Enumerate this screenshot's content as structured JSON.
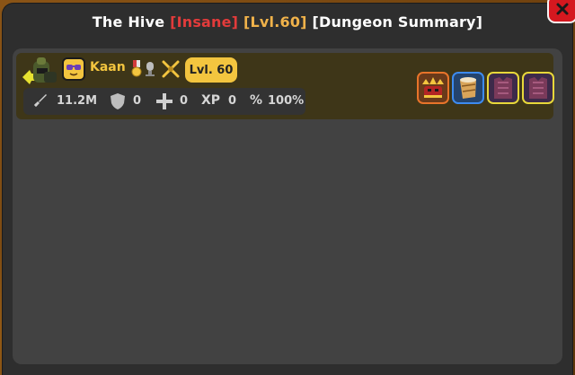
{
  "window": {
    "title_main": "The Hive",
    "difficulty": "[Insane]",
    "level": "[Lvl.60]",
    "summary_tag": "[Dungeon Summary]"
  },
  "player": {
    "name": "Kaan",
    "level_badge": "Lvl. 60",
    "stats": {
      "damage": "11.2M",
      "defense": "0",
      "healing": "0",
      "xp_label": "XP",
      "xp": "0",
      "percent_label": "%",
      "percent": "100%"
    },
    "items": [
      {
        "icon": "crowned-mask-item-icon",
        "rarity_color": "#e8742a"
      },
      {
        "icon": "drum-item-icon",
        "rarity_color": "#3d8bf0"
      },
      {
        "icon": "chestplate-item-icon",
        "rarity_color": "#e8d83a"
      },
      {
        "icon": "chestplate-item-icon",
        "rarity_color": "#e8d83a"
      }
    ]
  },
  "colors": {
    "accent_gold": "#f3c53f",
    "difficulty_red": "#e23b3b",
    "level_orange": "#f0b24a",
    "close_red": "#d5181f"
  }
}
